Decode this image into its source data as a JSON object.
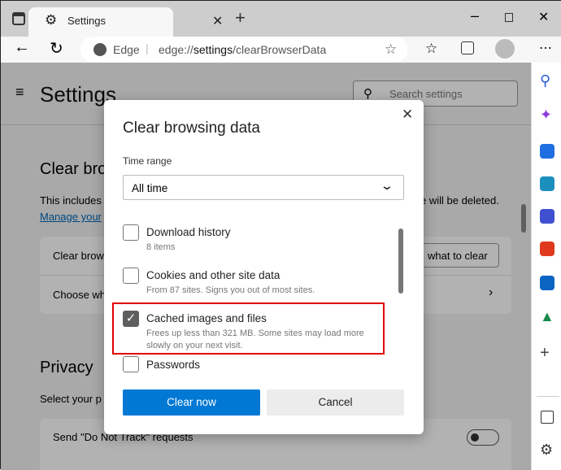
{
  "browser": {
    "tab_title": "Settings",
    "address_site": "Edge",
    "address_url_prefix": "edge://",
    "address_url_bold": "settings",
    "address_url_suffix": "/clearBrowserData"
  },
  "settings": {
    "title": "Settings",
    "search_placeholder": "Search settings",
    "section1_heading": "Clear bro",
    "section1_desc_left": "This includes",
    "section1_desc_right": "e will be deleted.",
    "manage_link": "Manage your",
    "row1_label": "Clear brow",
    "row1_button": "what to clear",
    "row2_label": "Choose wh",
    "privacy_heading": "Privacy",
    "privacy_desc": "Select your p",
    "dnt_label": "Send \"Do Not Track\" requests"
  },
  "dialog": {
    "title": "Clear browsing data",
    "time_range_label": "Time range",
    "time_range_value": "All time",
    "items": [
      {
        "label": "Download history",
        "sub": "8 items",
        "checked": false
      },
      {
        "label": "Cookies and other site data",
        "sub": "From 87 sites. Signs you out of most sites.",
        "checked": false
      },
      {
        "label": "Cached images and files",
        "sub": "Frees up less than 321 MB. Some sites may load more slowly on your next visit.",
        "checked": true
      },
      {
        "label": "Passwords",
        "sub": "",
        "checked": false
      }
    ],
    "clear_button": "Clear now",
    "cancel_button": "Cancel"
  },
  "colors": {
    "accent": "#0078d4",
    "highlight": "#e00000"
  }
}
